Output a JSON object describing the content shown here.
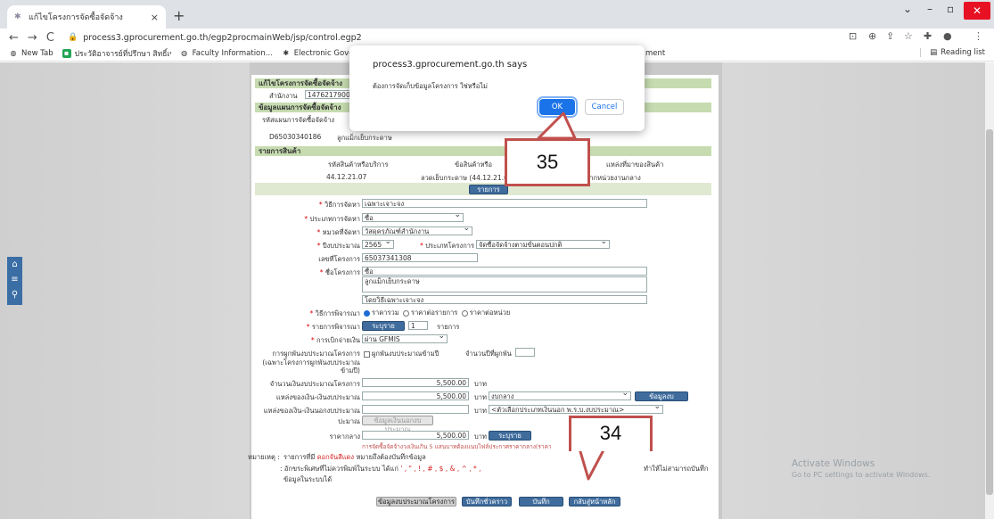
{
  "browser": {
    "tab_title": "แก้ไขโครงการจัดซื้อจัดจ้าง",
    "url": "process3.gprocurement.go.th/egp2procmainWeb/jsp/control.egp2",
    "bookmarks": [
      "New Tab",
      "ประวัติอาจารย์ที่ปรึกษา สิทธิ์เข้าถึงข้อมูลอาจารย์ผู้ติด...",
      "Faculty Information...",
      "Electronic Governm...",
      "ment"
    ],
    "reading_list": "Reading list"
  },
  "form": {
    "section_header": "แก้ไขโครงการจัดซื้อจัดจ้าง",
    "agency_label": "สำนักงาน",
    "agency_value": "14762179007",
    "plan_header": "ข้อมูลแผนการจัดซื้อจัดจ้าง",
    "plan_code_label": "รหัสแผนการจัดซื้อจัดจ้าง",
    "plan_code": "D65030340186",
    "plan_name": "ลูกแม็กเย็บกระดาษ",
    "items_header": "รายการสินค้า",
    "col_item_code": "รหัสสินค้าหรือบริการ",
    "col_item_name": "ข้อสินค้าหรือ",
    "col_source": "แหล่งที่มาของสินค้า",
    "item_code": "44.12.21.07",
    "item_name": "ลวดเย็บกระดาษ (44.12.21.07)",
    "item_source": "สินค้าจากหน่วยงานกลาง",
    "items_button": "รายการสินค้า",
    "method_label": "วิธีการจัดหา",
    "method_value": "เฉพาะเจาะจง",
    "proc_type_label": "ประเภทการจัดหา",
    "proc_type_value": "ซื้อ",
    "category_label": "หมวดที่จัดหา",
    "category_value": "วัสดุครุภัณฑ์สำนักงาน",
    "budget_year_label": "ปีงบประมาณ",
    "budget_year_value": "2565",
    "project_type_label": "ประเภทโครงการ",
    "project_type_value": "จัดซื้อจัดจ้างตามขั้นตอนปกติ",
    "project_no_label": "เลขที่โครงการ",
    "project_no_value": "65037341308",
    "project_name_label": "ชื่อโครงการ",
    "project_name_prefix": "ซื้อ",
    "project_name_value": "ลูกแม็กเย็บกระดาษ",
    "project_name_suffix": "โดยวิธีเฉพาะเจาะจง",
    "consider_label": "วิธีการพิจารณา",
    "consider_opt1": "ราคารวม",
    "consider_opt2": "ราคาต่อรายการ",
    "consider_opt3": "ราคาต่อหน่วย",
    "consider_items_label": "รายการพิจารณา",
    "consider_items_btn": "ระบุรายละเอียด",
    "consider_items_count": "1",
    "consider_items_unit": "รายการ",
    "disburse_label": "การเบิกจ่ายเงิน",
    "disburse_value": "ผ่าน GFMIS",
    "multi_year_label": "การผูกพันงบประมาณโครงการ",
    "multi_year_check": "ผูกพันงบประมาณข้ามปี",
    "multi_year_count_label": "จำนวนปีที่ผูกพัน",
    "multi_year_note": "(เฉพาะโครงการผูกพันงบประมาณข้ามปี)",
    "budget_label": "จำนวนเงินงบประมาณโครงการ",
    "budget_value": "5,500.00",
    "baht": "บาท",
    "budget_src_label": "แหล่งของเงิน-เงินงบประมาณ",
    "budget_src_value": "5,500.00",
    "budget_src_select": "งบกลาง",
    "budget_info_btn": "ข้อมูลงบประมาณ",
    "offbudget_label": "แหล่งของเงิน-เงินนอกงบประมาณ",
    "offbudget_select": "<ตัวเลือกประเภทเงินนอก พ.ร.บ.งบประมาณ>",
    "offbudget_btn": "ข้อมูลเงินนอกงบประมาณ",
    "median_label": "ราคากลาง",
    "median_value": "5,500.00",
    "median_btn": "ระบุรายละเอียด",
    "median_note": "การจัดซื้อจัดจ้างวงเงินเกิน 5 แสนบาทต้องแนบไฟล์ประกาศราคากลาง(ราคา",
    "note_label": "หมายเหตุ :",
    "note_line1_pre": "รายการที่มี",
    "note_line1_red": "ดอกจันสีแดง",
    "note_line1_post": "หมายถึงต้องบันทึกข้อมูล",
    "note_line2_pre": ": อักขระพิเศษที่ไม่ควรพิมพ์ในระบบ ได้แก่",
    "note_line2_red": "' , \" , ! , # , $ , & , ^ , * , / , \\ , ; , : , @",
    "note_line2_post": "ทำให้ไม่สามารถบันทึก",
    "note_line3": "ข้อมูลในระบบได้",
    "btn_budget_info": "ข้อมูลงบประมาณโครงการ",
    "btn_draft": "บันทึกชั่วคราว",
    "btn_save": "บันทึก",
    "btn_back": "กลับสู่หน้าหลัก"
  },
  "dialog": {
    "title": "process3.gprocurement.go.th says",
    "message": "ต้องการจัดเก็บข้อมูลโครงการ ใช่หรือไม่",
    "ok": "OK",
    "cancel": "Cancel"
  },
  "annotations": {
    "callout_ok": "35",
    "callout_save": "34"
  },
  "watermark": {
    "title": "Activate Windows",
    "subtitle": "Go to PC settings to activate Windows."
  },
  "colors": {
    "header_green": "#c6dcb0",
    "button_blue": "#3f6c9c",
    "callout_red": "#c0504d",
    "dialog_ok": "#1a73e8"
  }
}
